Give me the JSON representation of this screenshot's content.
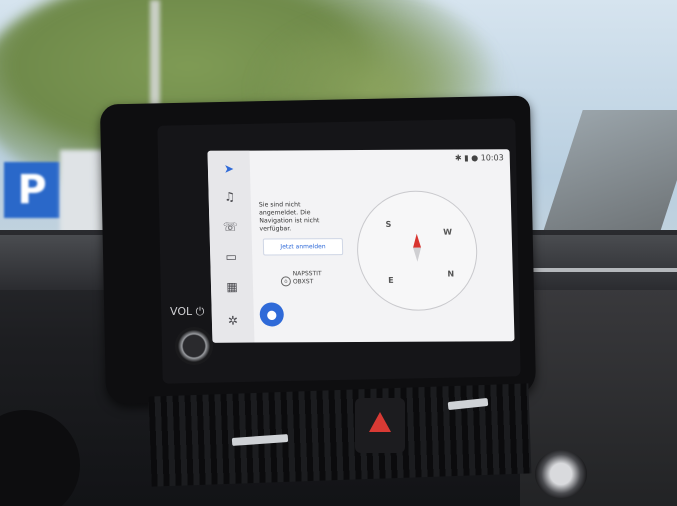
{
  "screen": {
    "status": {
      "time": "10:03",
      "icons": [
        "bluetooth-icon",
        "signal-icon",
        "mic-icon"
      ]
    },
    "rail": [
      "navigation-icon",
      "music-icon",
      "phone-icon",
      "car-icon",
      "apps-icon",
      "settings-icon"
    ],
    "message": "Sie sind nicht angemeldet. Die Navigation ist nicht verfügbar.",
    "signin_button": "Jetzt anmelden",
    "address_line1": "NAPSSTIT",
    "address_line2": "OBXST",
    "compass": {
      "n": "N",
      "s": "S",
      "w": "W",
      "e": "E"
    }
  },
  "hardware": {
    "vol_label": "VOL ⏻"
  },
  "colors": {
    "accent": "#2f6ad8",
    "needle": "#d8342f",
    "hazard": "#d83a34"
  }
}
